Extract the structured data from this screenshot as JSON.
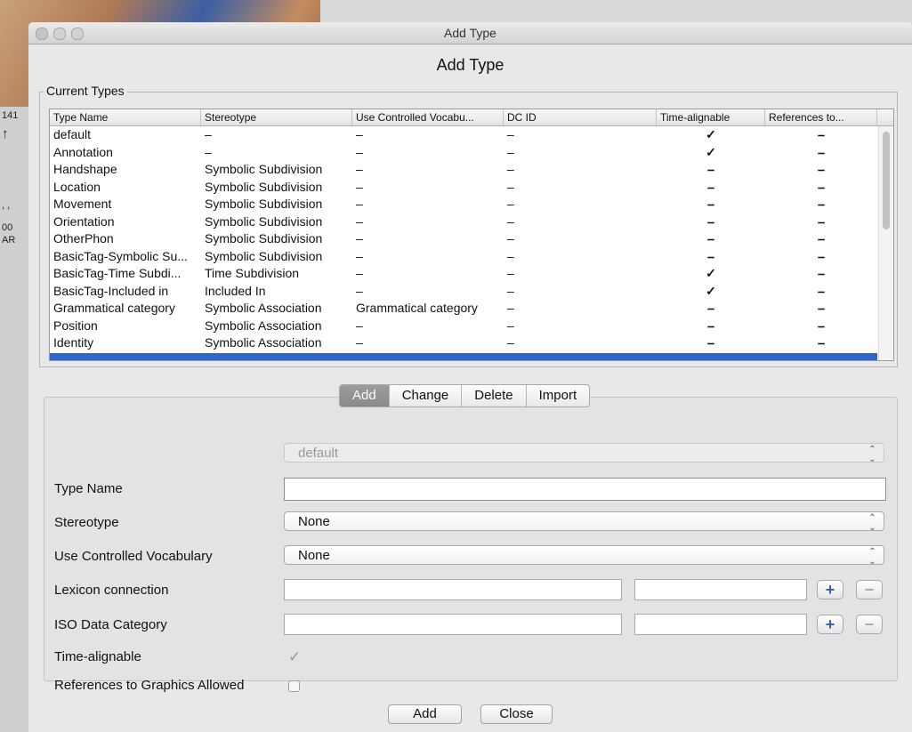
{
  "window": {
    "title": "Add Type",
    "heading": "Add Type"
  },
  "background": {
    "strip_labels": [
      "141",
      "↑",
      ",  ,",
      "00",
      "AR"
    ]
  },
  "current_types": {
    "legend": "Current Types",
    "columns": [
      "Type Name",
      "Stereotype",
      "Use Controlled Vocabu...",
      "DC ID",
      "Time-alignable",
      "References to..."
    ],
    "rows": [
      {
        "name": "default",
        "stereotype": "–",
        "vocab": "–",
        "dcid": "–",
        "time": "✓",
        "refs": "⎯"
      },
      {
        "name": "Annotation",
        "stereotype": "–",
        "vocab": "–",
        "dcid": "–",
        "time": "✓",
        "refs": "⎯"
      },
      {
        "name": "Handshape",
        "stereotype": "Symbolic Subdivision",
        "vocab": "–",
        "dcid": "–",
        "time": "⎯",
        "refs": "⎯"
      },
      {
        "name": "Location",
        "stereotype": "Symbolic Subdivision",
        "vocab": "–",
        "dcid": "–",
        "time": "⎯",
        "refs": "⎯"
      },
      {
        "name": "Movement",
        "stereotype": "Symbolic Subdivision",
        "vocab": "–",
        "dcid": "–",
        "time": "⎯",
        "refs": "⎯"
      },
      {
        "name": "Orientation",
        "stereotype": "Symbolic Subdivision",
        "vocab": "–",
        "dcid": "–",
        "time": "⎯",
        "refs": "⎯"
      },
      {
        "name": "OtherPhon",
        "stereotype": "Symbolic Subdivision",
        "vocab": "–",
        "dcid": "–",
        "time": "⎯",
        "refs": "⎯"
      },
      {
        "name": "BasicTag-Symbolic Su...",
        "stereotype": "Symbolic Subdivision",
        "vocab": "–",
        "dcid": "–",
        "time": "⎯",
        "refs": "⎯"
      },
      {
        "name": "BasicTag-Time Subdi...",
        "stereotype": "Time Subdivision",
        "vocab": "–",
        "dcid": "–",
        "time": "✓",
        "refs": "⎯"
      },
      {
        "name": "BasicTag-Included in",
        "stereotype": "Included In",
        "vocab": "–",
        "dcid": "–",
        "time": "✓",
        "refs": "⎯"
      },
      {
        "name": "Grammatical category",
        "stereotype": "Symbolic Association",
        "vocab": "Grammatical category",
        "dcid": "–",
        "time": "⎯",
        "refs": "⎯"
      },
      {
        "name": "Position",
        "stereotype": "Symbolic Association",
        "vocab": "–",
        "dcid": "–",
        "time": "⎯",
        "refs": "⎯"
      },
      {
        "name": "Identity",
        "stereotype": "Symbolic Association",
        "vocab": "–",
        "dcid": "–",
        "time": "⎯",
        "refs": "⎯"
      }
    ]
  },
  "tabs": [
    "Add",
    "Change",
    "Delete",
    "Import"
  ],
  "form": {
    "type_select": "default",
    "type_name_label": "Type Name",
    "type_name_value": "",
    "stereotype_label": "Stereotype",
    "stereotype_value": "None",
    "vocab_label": "Use Controlled Vocabulary",
    "vocab_value": "None",
    "lexicon_label": "Lexicon connection",
    "iso_label": "ISO Data Category",
    "time_label": "Time-alignable",
    "refs_label": "References to Graphics Allowed",
    "plus": "+",
    "minus": "−",
    "check_mark": "✓",
    "arrows": "⌃⌄"
  },
  "buttons": {
    "add": "Add",
    "close": "Close"
  }
}
